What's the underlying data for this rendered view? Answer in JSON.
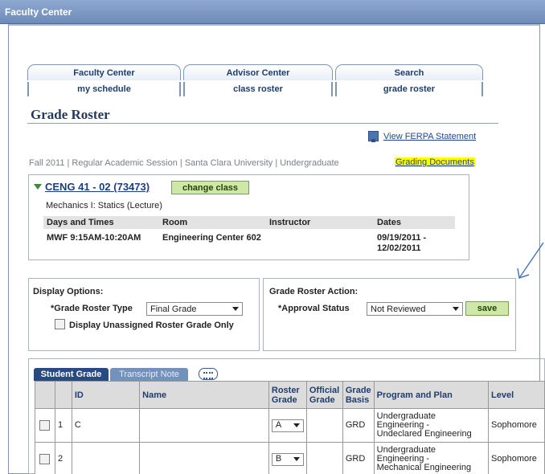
{
  "window": {
    "title": "Faculty Center"
  },
  "top_tabs": [
    "Faculty Center",
    "Advisor Center",
    "Search"
  ],
  "sub_tabs": [
    "my schedule",
    "class roster",
    "grade roster"
  ],
  "page_title": "Grade Roster",
  "ferpa_link": "View FERPA Statement",
  "term_text": "Fall 2011 | Regular Academic Session | Santa Clara University | Undergraduate",
  "grading_documents": "Grading Documents",
  "class": {
    "link": "CENG 41 - 02 (73473)",
    "change_button": "change class",
    "course_title": "Mechanics I: Statics (Lecture)",
    "headers": [
      "Days and Times",
      "Room",
      "Instructor",
      "Dates"
    ],
    "days_times": "MWF 9:15AM-10:20AM",
    "room": "Engineering Center 602",
    "instructor": "",
    "dates_line1": "09/19/2011 -",
    "dates_line2": "12/02/2011"
  },
  "display_options": {
    "label": "Display Options:",
    "type_label": "*Grade Roster Type",
    "type_value": "Final Grade",
    "checkbox_label": "Display Unassigned Roster Grade Only"
  },
  "roster_action": {
    "label": "Grade Roster Action:",
    "status_label": "*Approval Status",
    "status_value": "Not Reviewed",
    "save_label": "save"
  },
  "grid": {
    "tabs": [
      "Student Grade",
      "Transcript Note"
    ],
    "headers": {
      "id": "ID",
      "name": "Name",
      "roster_grade_1": "Roster",
      "roster_grade_2": "Grade",
      "official_grade_1": "Official",
      "official_grade_2": "Grade",
      "grade_basis_1": "Grade",
      "grade_basis_2": "Basis",
      "program": "Program and Plan",
      "level": "Level"
    },
    "rows": [
      {
        "num": "1",
        "id": "C",
        "name": "",
        "roster_grade": "A",
        "official_grade": "",
        "grade_basis": "GRD",
        "program_1": "Undergraduate",
        "program_2": "Engineering -",
        "program_3": "Undeclared Engineering",
        "level": "Sophomore"
      },
      {
        "num": "2",
        "id": "",
        "name": "",
        "roster_grade": "B",
        "official_grade": "",
        "grade_basis": "GRD",
        "program_1": "Undergraduate",
        "program_2": "Engineering -",
        "program_3": "Mechanical Engineering",
        "level": "Sophomore"
      }
    ]
  },
  "colors": {
    "title_bar": "#7a96c2",
    "tab_active": "#274a82",
    "button_green": "#cfe8a8",
    "highlight": "#ffff00",
    "annotation_arrow": "#4a78c4"
  }
}
